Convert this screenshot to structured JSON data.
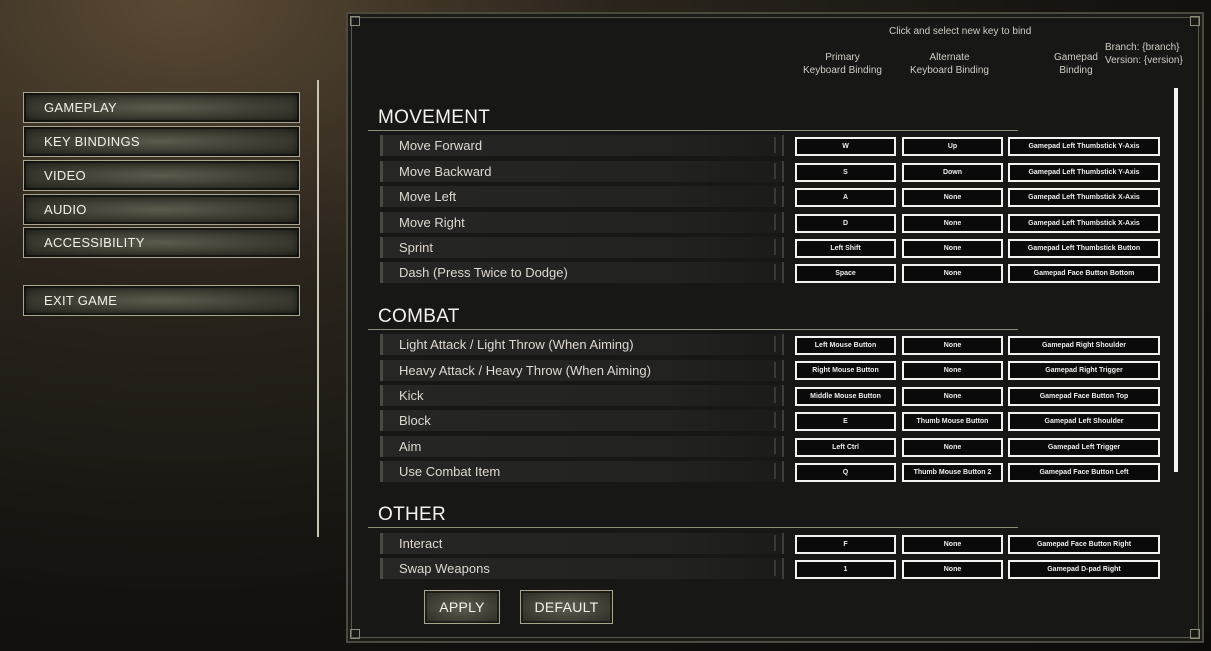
{
  "menu": {
    "items": [
      {
        "label": "GAMEPLAY"
      },
      {
        "label": "KEY BINDINGS"
      },
      {
        "label": "VIDEO"
      },
      {
        "label": "AUDIO"
      },
      {
        "label": "ACCESSIBILITY"
      }
    ],
    "exit_label": "EXIT GAME"
  },
  "header": {
    "hint": "Click and select new key to bind",
    "col_primary_1": "Primary",
    "col_primary_2": "Keyboard Binding",
    "col_alternate_1": "Alternate",
    "col_alternate_2": "Keyboard Binding",
    "col_gamepad_1": "Gamepad",
    "col_gamepad_2": "Binding",
    "branch": "Branch: {branch}",
    "version": "Version: {version}"
  },
  "sections": [
    {
      "title": "MOVEMENT",
      "rows": [
        {
          "action": "Move Forward",
          "primary": "W",
          "alternate": "Up",
          "gamepad": "Gamepad Left Thumbstick Y-Axis"
        },
        {
          "action": "Move Backward",
          "primary": "S",
          "alternate": "Down",
          "gamepad": "Gamepad Left Thumbstick Y-Axis"
        },
        {
          "action": "Move Left",
          "primary": "A",
          "alternate": "None",
          "gamepad": "Gamepad Left Thumbstick X-Axis"
        },
        {
          "action": "Move Right",
          "primary": "D",
          "alternate": "None",
          "gamepad": "Gamepad Left Thumbstick X-Axis"
        },
        {
          "action": "Sprint",
          "primary": "Left Shift",
          "alternate": "None",
          "gamepad": "Gamepad Left Thumbstick Button"
        },
        {
          "action": "Dash (Press Twice to Dodge)",
          "primary": "Space",
          "alternate": "None",
          "gamepad": "Gamepad Face Button Bottom"
        }
      ]
    },
    {
      "title": "COMBAT",
      "rows": [
        {
          "action": "Light Attack / Light Throw (When Aiming)",
          "primary": "Left Mouse Button",
          "alternate": "None",
          "gamepad": "Gamepad Right Shoulder"
        },
        {
          "action": "Heavy Attack / Heavy Throw (When Aiming)",
          "primary": "Right Mouse Button",
          "alternate": "None",
          "gamepad": "Gamepad Right Trigger"
        },
        {
          "action": "Kick",
          "primary": "Middle Mouse Button",
          "alternate": "None",
          "gamepad": "Gamepad Face Button Top"
        },
        {
          "action": "Block",
          "primary": "E",
          "alternate": "Thumb Mouse Button",
          "gamepad": "Gamepad Left Shoulder"
        },
        {
          "action": "Aim",
          "primary": "Left Ctrl",
          "alternate": "None",
          "gamepad": "Gamepad Left Trigger"
        },
        {
          "action": "Use Combat Item",
          "primary": "Q",
          "alternate": "Thumb Mouse Button 2",
          "gamepad": "Gamepad Face Button Left"
        }
      ]
    },
    {
      "title": "OTHER",
      "rows": [
        {
          "action": "Interact",
          "primary": "F",
          "alternate": "None",
          "gamepad": "Gamepad Face Button Right"
        },
        {
          "action": "Swap Weapons",
          "primary": "1",
          "alternate": "None",
          "gamepad": "Gamepad D-pad Right"
        }
      ]
    }
  ],
  "footer": {
    "apply_label": "APPLY",
    "default_label": "DEFAULT"
  }
}
